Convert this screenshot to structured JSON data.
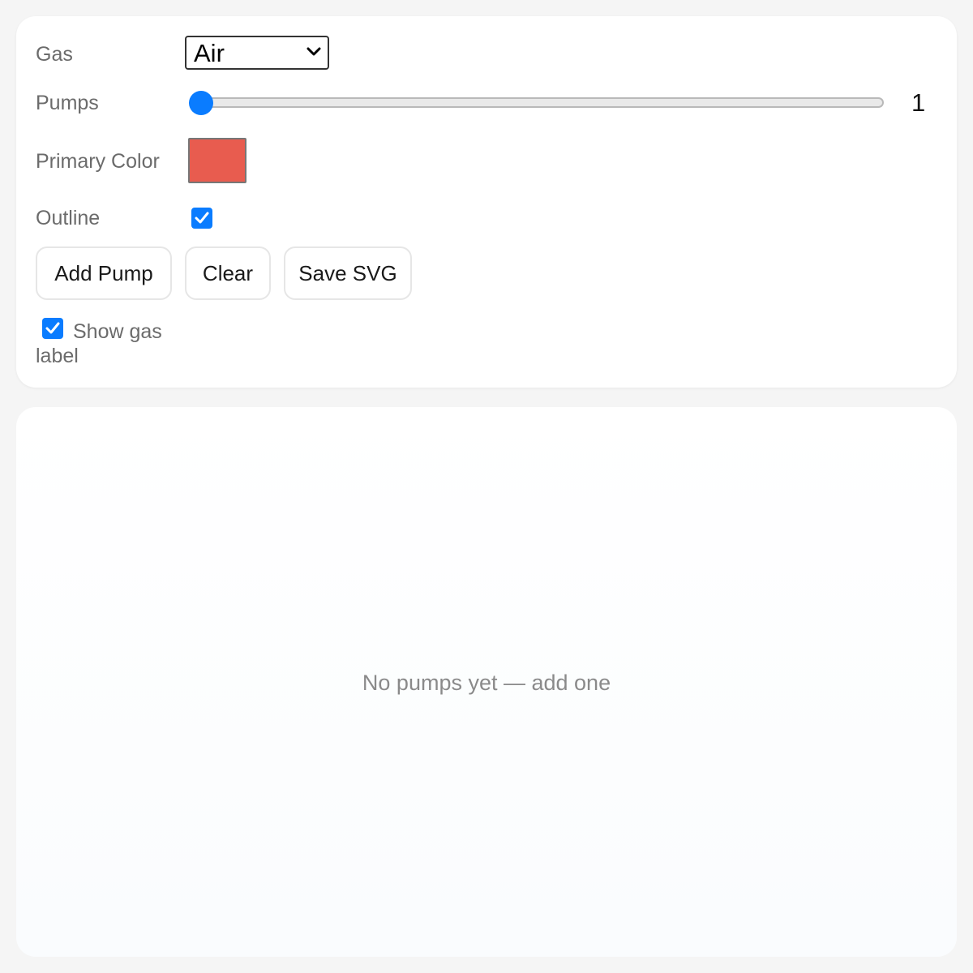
{
  "controls": {
    "gas_label": "Gas",
    "gas_value": "Air",
    "pumps_label": "Pumps",
    "pumps_value": "1",
    "pumps_range": {
      "min": 1,
      "max": 10,
      "value": 1
    },
    "primary_color_label": "Primary Color",
    "primary_color": "#e85c4f",
    "outline_label": "Outline",
    "outline_checked": true
  },
  "buttons": {
    "add_pump": "Add Pump",
    "clear": "Clear",
    "save_svg": "Save SVG"
  },
  "show_gas": {
    "label_line1": "Show gas",
    "label_line2": "label",
    "checked": true
  },
  "canvas": {
    "empty_message": "No pumps yet — add one"
  },
  "colors": {
    "accent": "#0a7cff",
    "background": "#f5f5f5",
    "panel": "#ffffff",
    "muted_text": "#6b6b6b"
  },
  "icons": {
    "select_arrow": "chevron-down-icon",
    "checkbox_mark": "checkmark-icon"
  }
}
